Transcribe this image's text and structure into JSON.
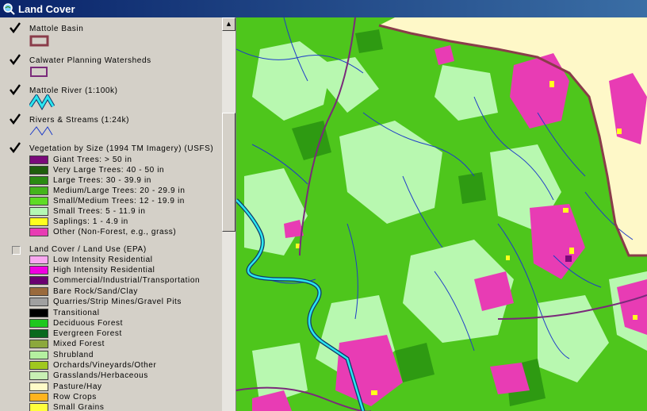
{
  "window": {
    "title": "Land Cover",
    "icon": "magnifier-globe-icon"
  },
  "legend": {
    "layers": [
      {
        "name": "Mattole Basin",
        "checked": true,
        "symbol": "brown-outline-rect"
      },
      {
        "name": "Calwater Planning Watersheds",
        "checked": true,
        "symbol": "purple-outline-rect"
      },
      {
        "name": "Mattole River (1:100k)",
        "checked": true,
        "symbol": "cyan-zigzag-line"
      },
      {
        "name": "Rivers & Streams (1:24k)",
        "checked": true,
        "symbol": "blue-zigzag-line"
      },
      {
        "name": "Vegetation by Size (1994 TM Imagery) (USFS)",
        "checked": true,
        "classes": [
          {
            "label": "Giant Trees: > 50 in",
            "color": "#7a0a7a"
          },
          {
            "label": "Very Large Trees: 40 - 50 in",
            "color": "#1e5e0c"
          },
          {
            "label": "Large Trees: 30 - 39.9 in",
            "color": "#2a8a12"
          },
          {
            "label": "Medium/Large Trees: 20 - 29.9 in",
            "color": "#44b41c"
          },
          {
            "label": "Small/Medium Trees: 12 - 19.9 in",
            "color": "#5edc24"
          },
          {
            "label": "Small Trees: 5 - 11.9 in",
            "color": "#b4f8b4"
          },
          {
            "label": "Saplings: 1 - 4.9 in",
            "color": "#ffff1e"
          },
          {
            "label": "Other (Non-Forest, e.g., grass)",
            "color": "#e83cb4"
          }
        ]
      },
      {
        "name": "Land Cover / Land Use (EPA)",
        "checked": false,
        "classes": [
          {
            "label": "Low Intensity Residential",
            "color": "#f8a8f0"
          },
          {
            "label": "High Intensity Residential",
            "color": "#f000e0"
          },
          {
            "label": "Commercial/Industrial/Transportation",
            "color": "#6a0070"
          },
          {
            "label": "Bare Rock/Sand/Clay",
            "color": "#9a6a3c"
          },
          {
            "label": "Quarries/Strip Mines/Gravel Pits",
            "color": "#a0a0a0"
          },
          {
            "label": "Transitional",
            "color": "#000000"
          },
          {
            "label": "Deciduous Forest",
            "color": "#1ec81e"
          },
          {
            "label": "Evergreen Forest",
            "color": "#0a6a1e"
          },
          {
            "label": "Mixed Forest",
            "color": "#8ca83c"
          },
          {
            "label": "Shrubland",
            "color": "#b4f0a0"
          },
          {
            "label": "Orchards/Vineyards/Other",
            "color": "#a0c81e"
          },
          {
            "label": "Grasslands/Herbaceous",
            "color": "#c8f0b4"
          },
          {
            "label": "Pasture/Hay",
            "color": "#fffcc8"
          },
          {
            "label": "Row Crops",
            "color": "#ffb41e"
          },
          {
            "label": "Small Grains",
            "color": "#ffff3c"
          }
        ]
      }
    ]
  },
  "map": {
    "colors": {
      "background": "#fef8c8",
      "medium_large": "#4ec61c",
      "large": "#2e9a12",
      "small_trees": "#b8f8b0",
      "small_medium": "#6ee62c",
      "saplings": "#ffff1e",
      "non_forest": "#e83cb4",
      "very_large": "#1e5e0c",
      "giant": "#7a0a7a",
      "basin_outline": "#8a3c4a",
      "watershed_outline": "#7a2a7a",
      "river": "#2ae6f0",
      "stream": "#1e3cc8"
    }
  }
}
